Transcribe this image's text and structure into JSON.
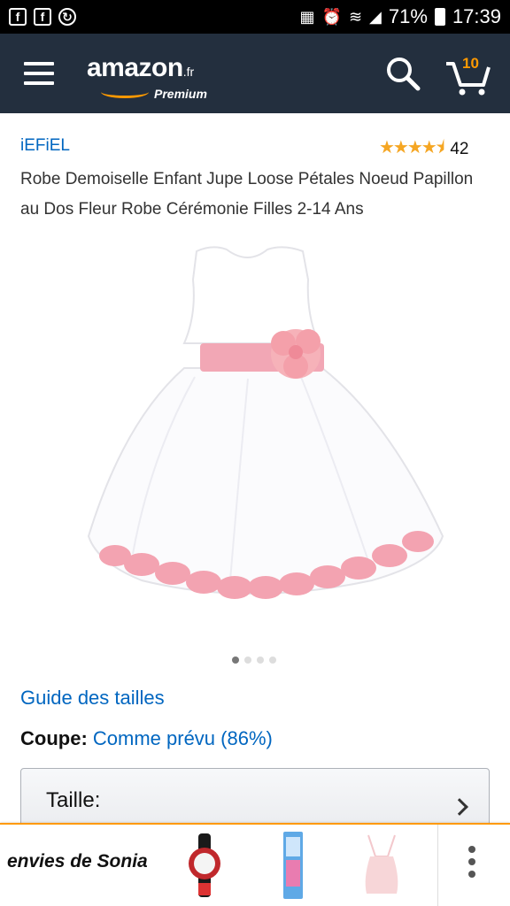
{
  "status": {
    "battery_percent": "71%",
    "time": "17:39"
  },
  "header": {
    "logo_text": "amazon",
    "logo_tld": ".fr",
    "logo_sub": "Premium",
    "cart_count": "10"
  },
  "product": {
    "brand": "iEFiEL",
    "rating_stars": 4.5,
    "rating_count": "42",
    "title": "Robe Demoiselle Enfant Jupe Loose Pétales Noeud Papillon au Dos Fleur Robe Cérémonie Filles 2-14 Ans",
    "image_count": 4,
    "active_image": 1
  },
  "size_guide": "Guide des tailles",
  "fit": {
    "label": "Coupe:",
    "value": "Comme prévu (86%)"
  },
  "size_selector": {
    "label": "Taille:"
  },
  "bottom_bar": {
    "title": "envies de Sonia"
  },
  "colors": {
    "header_bg": "#232f3e",
    "accent": "#ff9900",
    "link": "#0066c0"
  }
}
